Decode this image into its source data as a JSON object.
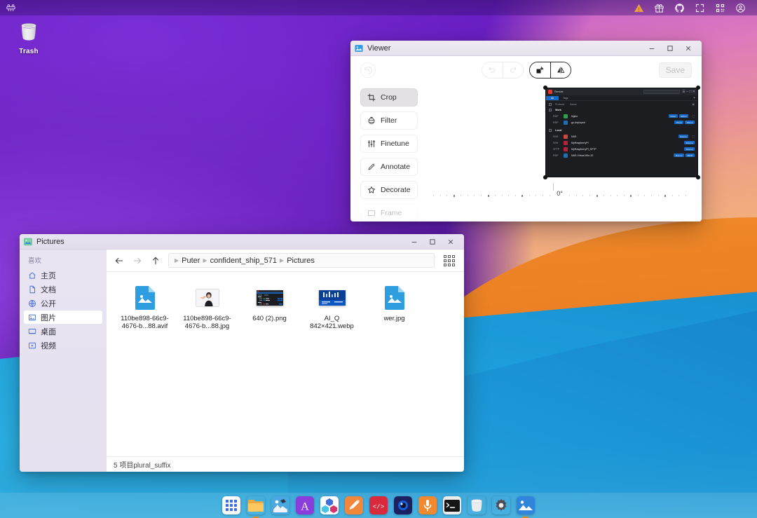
{
  "topbar": {
    "left_logo": "puter-logo-icon",
    "right_icons": [
      {
        "name": "warning-triangle-icon",
        "color": "#f0a93b"
      },
      {
        "name": "gift-icon",
        "color": "#ffffff"
      },
      {
        "name": "github-icon",
        "color": "#ffffff"
      },
      {
        "name": "fullscreen-icon",
        "color": "#ffffff"
      },
      {
        "name": "qr-code-icon",
        "color": "#ffffff"
      },
      {
        "name": "account-circle-icon",
        "color": "#ffffff"
      }
    ]
  },
  "desktop": {
    "icons": [
      {
        "name": "trash-icon",
        "label": "Trash"
      }
    ]
  },
  "viewer": {
    "title": "Viewer",
    "app_icon": "image-app-icon",
    "window_controls": {
      "minimize": "minimize-icon",
      "maximize": "maximize-icon",
      "close": "close-icon"
    },
    "toolbar": {
      "reset_icon": "history-reset-icon",
      "undo_icon": "undo-icon",
      "redo_icon": "redo-icon",
      "rotate_icon": "rotate-icon",
      "flip_icon": "flip-horizontal-icon",
      "save_label": "Save",
      "save_disabled": true
    },
    "tools": [
      {
        "label": "Crop",
        "icon": "crop-icon",
        "active": true
      },
      {
        "label": "Filter",
        "icon": "filter-icon",
        "active": false
      },
      {
        "label": "Finetune",
        "icon": "sliders-icon",
        "active": false
      },
      {
        "label": "Annotate",
        "icon": "pencil-icon",
        "active": false
      },
      {
        "label": "Decorate",
        "icon": "star-icon",
        "active": false
      },
      {
        "label": "Frame",
        "icon": "frame-icon",
        "active": false
      }
    ],
    "rotation": {
      "value_label": "0°",
      "degrees": 0
    },
    "preview": {
      "app_title": "Remote",
      "search_placeholder": "Search (Ctrl + F)",
      "tabs": [
        {
          "label": "All",
          "active": true
        },
        {
          "label": "Tags",
          "active": false
        }
      ],
      "columns": [
        "Protocol",
        "Name"
      ],
      "groups": [
        {
          "name": "Work",
          "rows": [
            {
              "protocol": "RDP",
              "name": "Nginx",
              "favicon_color": "#2e9e4f",
              "favicon_letter": "N",
              "tags": [
                "#Web",
                "#Work"
              ]
            },
            {
              "protocol": "RDP",
              "name": "go-deployed",
              "favicon_color": "#1f6fb2",
              "favicon_letter": "G",
              "tags": [
                "#Tech",
                "#Work"
              ]
            }
          ]
        },
        {
          "name": "Local",
          "rows": [
            {
              "protocol": "SSH",
              "name": "NAS",
              "favicon_color": "#c94a3a",
              "favicon_letter": "N",
              "tags": [
                "#Home"
              ]
            },
            {
              "protocol": "SSH",
              "name": "MyRaspberryPi",
              "favicon_color": "#b3243c",
              "favicon_letter": "R",
              "tags": [
                "#Home"
              ]
            },
            {
              "protocol": "SFTP",
              "name": "MyRaspberryPi_SFTP",
              "favicon_color": "#b3243c",
              "favicon_letter": "R",
              "tags": [
                "#Home"
              ]
            },
            {
              "protocol": "RDP",
              "name": "NAS-Virtual-Win-10",
              "favicon_color": "#1f6fb2",
              "favicon_letter": "W",
              "tags": [
                "#Home",
                "#RDP"
              ]
            }
          ]
        }
      ]
    }
  },
  "filemanager": {
    "title": "Pictures",
    "app_icon": "pictures-app-icon",
    "window_controls": {
      "minimize": "minimize-icon",
      "maximize": "maximize-icon",
      "close": "close-icon"
    },
    "nav": {
      "back_icon": "arrow-left-icon",
      "forward_icon": "arrow-right-icon",
      "up_icon": "arrow-up-icon",
      "view_toggle_icon": "grid-view-icon"
    },
    "breadcrumb": [
      "Puter",
      "confident_ship_571",
      "Pictures"
    ],
    "sidebar": {
      "header": "喜欢",
      "items": [
        {
          "label": "主页",
          "icon": "home-icon",
          "active": false
        },
        {
          "label": "文档",
          "icon": "document-icon",
          "active": false
        },
        {
          "label": "公开",
          "icon": "globe-icon",
          "active": false
        },
        {
          "label": "图片",
          "icon": "pictures-icon",
          "active": true
        },
        {
          "label": "桌面",
          "icon": "desktop-icon",
          "active": false
        },
        {
          "label": "视频",
          "icon": "video-icon",
          "active": false
        }
      ]
    },
    "files": [
      {
        "name": "110be898-66c9-4676-b...88.avif",
        "thumb": "generic-image-file"
      },
      {
        "name": "110be898-66c9-4676-b...88.jpg",
        "thumb": "photo-person"
      },
      {
        "name": "640 (2).png",
        "thumb": "dark-screenshot"
      },
      {
        "name": "AI_Q 842×421.webp",
        "thumb": "blue-screenshot"
      },
      {
        "name": "wer.jpg",
        "thumb": "generic-image-file"
      }
    ],
    "status": "5 项目plural_suffix"
  },
  "dock": {
    "items": [
      {
        "name": "app-grid",
        "icon": "grid-apps-icon",
        "running": false
      },
      {
        "name": "file-manager",
        "icon": "folder-icon",
        "running": true
      },
      {
        "name": "photos",
        "icon": "photos-icon",
        "running": false
      },
      {
        "name": "text-editor",
        "icon": "letter-a-icon",
        "running": false
      },
      {
        "name": "3d-viewer",
        "icon": "cubes-icon",
        "running": false
      },
      {
        "name": "paint",
        "icon": "paintbrush-icon",
        "running": false
      },
      {
        "name": "code-editor",
        "icon": "code-icon",
        "running": false
      },
      {
        "name": "recorder",
        "icon": "camera-icon",
        "running": false
      },
      {
        "name": "voice-recorder",
        "icon": "microphone-icon",
        "running": false
      },
      {
        "name": "terminal",
        "icon": "terminal-icon",
        "running": false
      },
      {
        "name": "trash",
        "icon": "trash-icon",
        "running": false
      },
      {
        "name": "settings",
        "icon": "gear-icon",
        "running": false
      },
      {
        "name": "image-viewer",
        "icon": "image-viewer-icon",
        "running": true
      }
    ]
  },
  "colors": {
    "accent_blue": "#2f9ee0",
    "wallpaper_purple": "#6a1fc4",
    "wallpaper_orange": "#e87a1e",
    "selected_blue": "#1769c4",
    "warning_orange": "#f0a93b"
  }
}
